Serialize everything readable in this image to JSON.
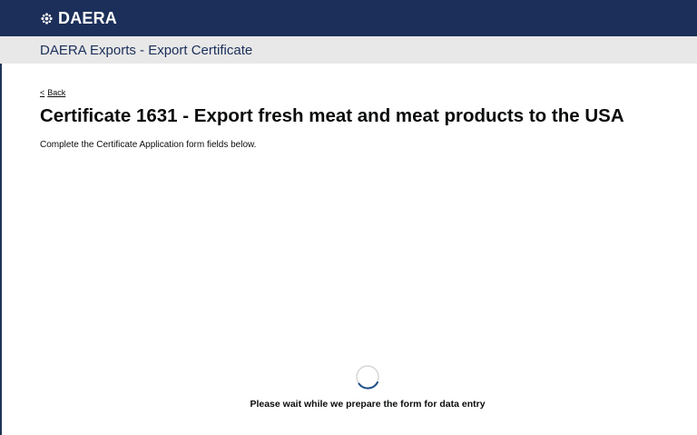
{
  "header": {
    "logo_icon": "daera-emblem-icon",
    "logo_text": "DAERA",
    "bg_color": "#1b2f5a"
  },
  "subheader": {
    "service_name": "DAERA Exports - Export Certificate",
    "bg_color": "#e8e8e8"
  },
  "main": {
    "back_icon": "chevron-left-icon",
    "back_label": "Back",
    "title": "Certificate 1631 - Export fresh meat and meat products to the USA",
    "intro": "Complete the Certificate Application form fields below.",
    "loading": {
      "spinner_icon": "loading-spinner-icon",
      "message": "Please wait while we prepare the form for data entry"
    }
  }
}
